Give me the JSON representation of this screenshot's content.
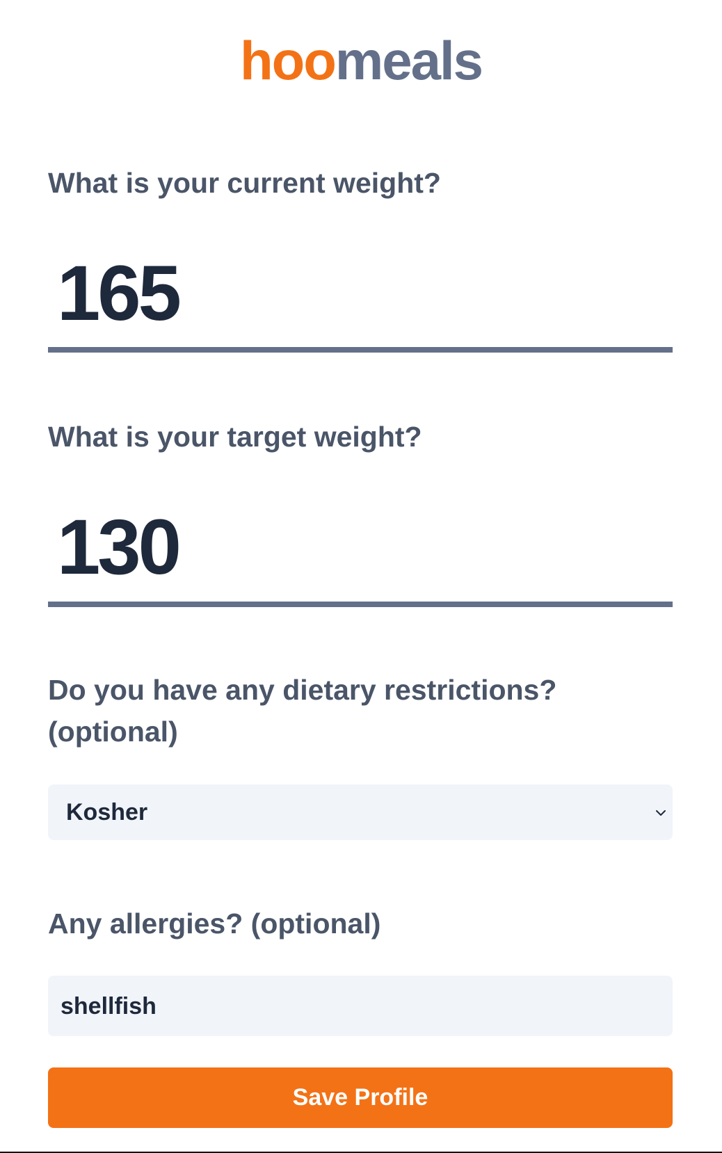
{
  "logo": {
    "part_a": "hoo",
    "part_b": "meals"
  },
  "colors": {
    "brand_orange": "#f37216",
    "brand_slate": "#64708a",
    "label_text": "#4a5568",
    "value_text": "#1e293b",
    "field_bg": "#f1f4f9"
  },
  "current_weight": {
    "label": "What is your current weight?",
    "value": "165"
  },
  "target_weight": {
    "label": "What is your target weight?",
    "value": "130"
  },
  "dietary": {
    "label_line1": "Do you have any dietary restrictions?",
    "label_line2": "(optional)",
    "selected": "Kosher",
    "icon": "chevron-down-icon"
  },
  "allergies": {
    "label": "Any allergies? (optional)",
    "value": "shellfish"
  },
  "save_button": {
    "label": "Save Profile"
  }
}
